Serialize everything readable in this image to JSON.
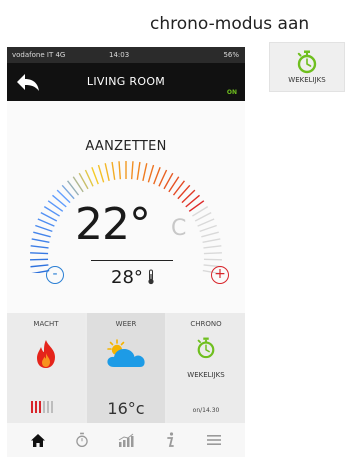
{
  "caption": "chrono-modus aan",
  "badge": {
    "label": "WEKELIJKS",
    "accent": "#6fbf1f"
  },
  "statusbar": {
    "carrier": "vodafone IT  4G",
    "time": "14:03",
    "battery": "56%"
  },
  "header": {
    "title": "LIVING ROOM",
    "status": "ON"
  },
  "thermostat": {
    "state_label": "AANZETTEN",
    "current_temp": "22°",
    "unit": "C",
    "target_temp": "28°",
    "minus_label": "-",
    "plus_label": "+",
    "colors": {
      "minus": "#2a7fd4",
      "plus": "#d8242a"
    }
  },
  "tiles": [
    {
      "title": "MACHT",
      "icon": "flame-icon",
      "level_active": 3,
      "level_total": 6
    },
    {
      "title": "WEER",
      "icon": "weather-icon",
      "value": "16°c"
    },
    {
      "title": "CHRONO",
      "icon": "stopwatch-icon",
      "mode": "WEKELIJKS",
      "value": "on/14.30"
    }
  ],
  "nav": [
    "home-icon",
    "chrono-icon",
    "stats-icon",
    "info-icon",
    "menu-icon"
  ]
}
